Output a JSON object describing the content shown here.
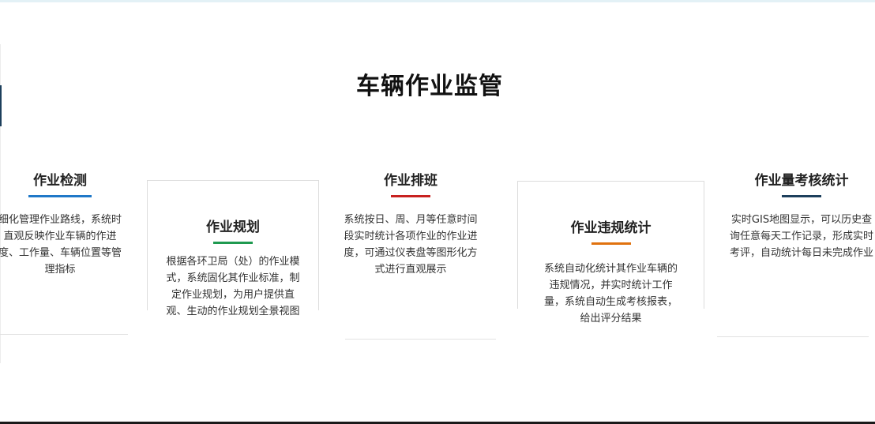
{
  "page_title": "车辆作业监管",
  "cards": [
    {
      "title": "作业检测",
      "desc": "细化管理作业路线，系统时直观反映作业车辆的作进度、工作量、车辆位置等管理指标",
      "accent": "#1f78c8"
    },
    {
      "title": "作业规划",
      "desc": "根据各环卫局（处）的作业模式，系统固化其作业标准，制定作业规划，为用户提供直观、生动的作业规划全景视图",
      "accent": "#1f9a50"
    },
    {
      "title": "作业排班",
      "desc": "系统按日、周、月等任意时间段实时统计各项作业的作业进度，可通过仪表盘等图形化方式进行直观展示",
      "accent": "#c8211f"
    },
    {
      "title": "作业违规统计",
      "desc": "系统自动化统计其作业车辆的违规情况，并实时统计工作量，系统自动生成考核报表，给出评分结果",
      "accent": "#e0720f"
    },
    {
      "title": "作业量考核统计",
      "desc": "实时GIS地图显示，可以历史查询任意每天工作记录，形成实时考评，自动统计每日未完成作业",
      "accent": "#1d3f5c"
    }
  ]
}
